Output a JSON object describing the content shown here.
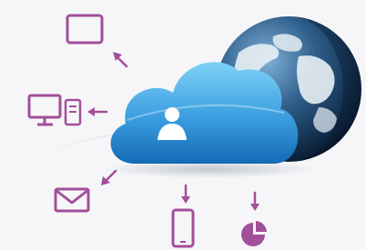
{
  "illustration": {
    "subject": "cloud-computing",
    "colors": {
      "background": "#f6f6f8",
      "cloud_light": "#6cc6f4",
      "cloud_dark": "#1a7fc8",
      "globe_ocean_light": "#5a8fb8",
      "globe_ocean_dark": "#0d2a4a",
      "globe_land": "#e8eef2",
      "device_icons": "#a24f9a",
      "user_icon": "#ffffff"
    },
    "icons": [
      "tablet-icon",
      "desktop-monitor-icon",
      "mail-envelope-icon",
      "smartphone-icon",
      "pie-chart-icon",
      "user-icon",
      "globe-icon"
    ]
  }
}
